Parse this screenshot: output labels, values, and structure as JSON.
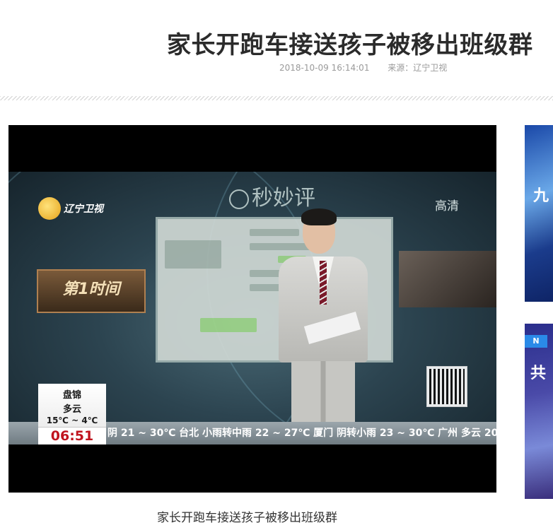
{
  "article": {
    "title": "家长开跑车接送孩子被移出班级群",
    "datetime": "2018-10-09 16:14:01",
    "source": "来源：辽宁卫视"
  },
  "video": {
    "channel_name": "辽宁卫视",
    "segment_name": "秒妙评",
    "show_name": "第1时间",
    "hd_label": "高清",
    "weather": {
      "city": "盘锦",
      "condition": "多云",
      "temperature": "15℃ ~ 4℃",
      "time": "06:51"
    },
    "ticker": "阴 21 ~ 30℃  台北 小雨转中雨 22 ~ 27℃  厦门 阴转小雨 23 ~ 30℃  广州 多云 20 ~"
  },
  "caption": "家长开跑车接送孩子被移出班级群",
  "side_ads": {
    "ad1_glyph": "九",
    "ad2_badge": "N",
    "ad2_glyph": "共"
  }
}
